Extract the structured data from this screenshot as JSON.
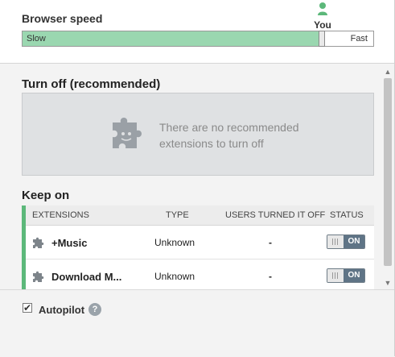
{
  "header": {
    "speed_title": "Browser speed",
    "you_label": "You",
    "slow_label": "Slow",
    "fast_label": "Fast",
    "speed_fraction": 0.85,
    "accent_color": "#9ad7b0"
  },
  "turn_off": {
    "title": "Turn off (recommended)",
    "empty_message_line1": "There are no recommended",
    "empty_message_line2": "extensions to turn off"
  },
  "keep_on": {
    "title": "Keep on",
    "columns": [
      "EXTENSIONS",
      "TYPE",
      "USERS TURNED IT OFF",
      "STATUS"
    ],
    "rows": [
      {
        "name": "+Music",
        "type": "Unknown",
        "users": "-",
        "status": "ON"
      },
      {
        "name": "Download M...",
        "type": "Unknown",
        "users": "-",
        "status": "ON"
      }
    ]
  },
  "footer": {
    "autopilot_label": "Autopilot",
    "autopilot_checked": "✔",
    "help_glyph": "?"
  },
  "scrollbar": {
    "up": "▲",
    "down": "▼"
  }
}
